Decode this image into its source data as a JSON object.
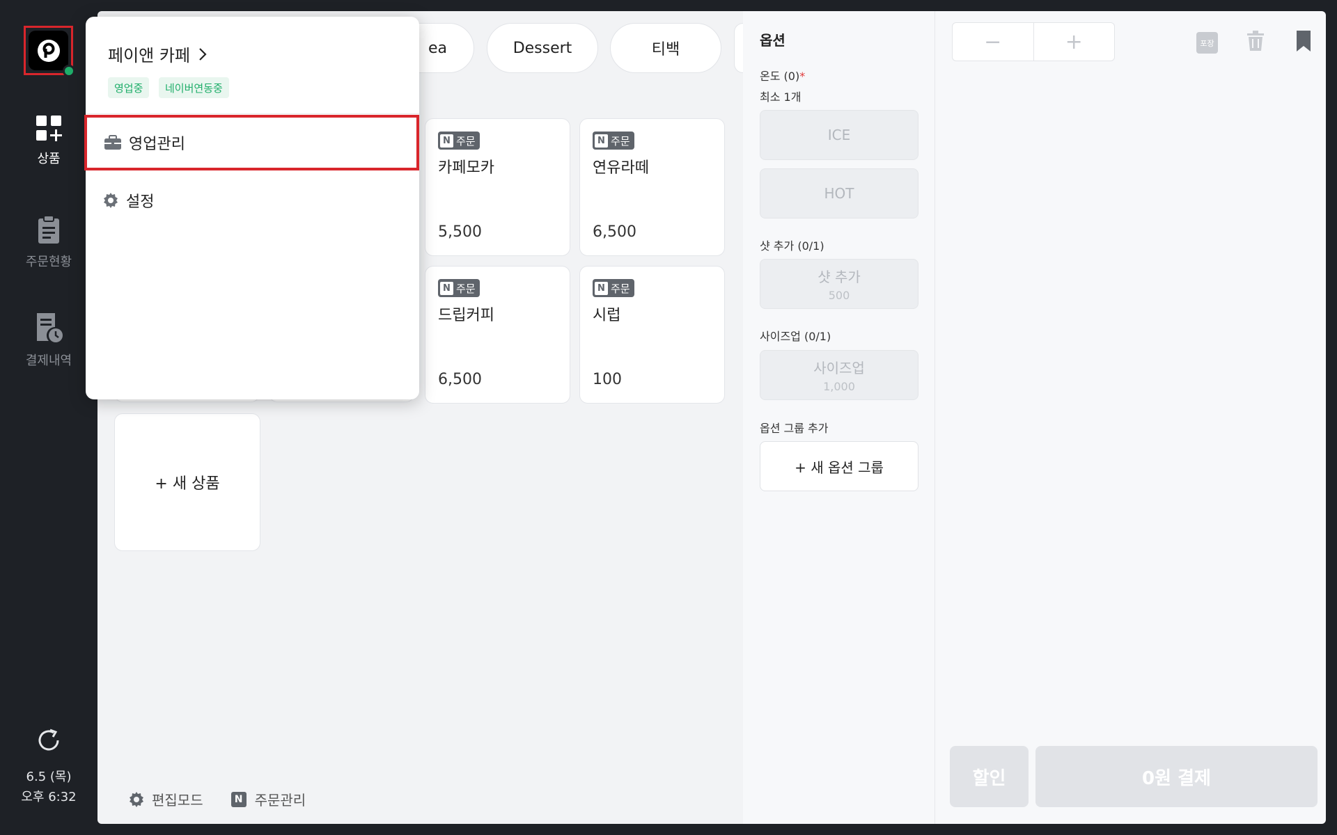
{
  "rail": {
    "items": [
      {
        "label": "상품",
        "icon": "grid-plus-icon"
      },
      {
        "label": "주문현황",
        "icon": "clipboard-icon"
      },
      {
        "label": "결제내역",
        "icon": "receipt-clock-icon"
      }
    ],
    "date": "6.5 (목)",
    "time": "오후 6:32"
  },
  "categories": [
    "ea",
    "Dessert",
    "티백"
  ],
  "products": [
    {
      "badge": "주문",
      "name": "카페모카",
      "price": "5,500"
    },
    {
      "badge": "주문",
      "name": "연유라떼",
      "price": "6,500"
    },
    {
      "badge": "주문",
      "name": "드립커피",
      "price": "6,500"
    },
    {
      "badge": "주문",
      "name": "시럽",
      "price": "100"
    }
  ],
  "new_product_label": "+ 새 상품",
  "bottom_tools": {
    "edit_mode": "편집모드",
    "order_manage": "주문관리",
    "n_glyph": "N"
  },
  "options": {
    "title": "옵션",
    "temp_label": "온도 (0)",
    "temp_required": "*",
    "temp_min": "최소 1개",
    "ice": "ICE",
    "hot": "HOT",
    "shot_label": "샷 추가 (0/1)",
    "shot_btn": "샷 추가",
    "shot_price": "500",
    "size_label": "사이즈업 (0/1)",
    "size_btn": "사이즈업",
    "size_price": "1,000",
    "group_label": "옵션 그룹 추가",
    "group_btn": "+ 새 옵션 그룹"
  },
  "cart": {
    "minus": "−",
    "plus": "+",
    "pack_badge": "포장",
    "discount": "할인",
    "pay": "0원 결제"
  },
  "dropdown": {
    "store_name": "페이앤 카페",
    "tags": [
      "영업중",
      "네이버연동중"
    ],
    "items": [
      {
        "label": "영업관리",
        "icon": "briefcase-icon"
      },
      {
        "label": "설정",
        "icon": "gear-icon"
      }
    ]
  },
  "colors": {
    "accent_red": "#d9262c",
    "green": "#1fae6a",
    "rail_bg": "#1e2126"
  }
}
